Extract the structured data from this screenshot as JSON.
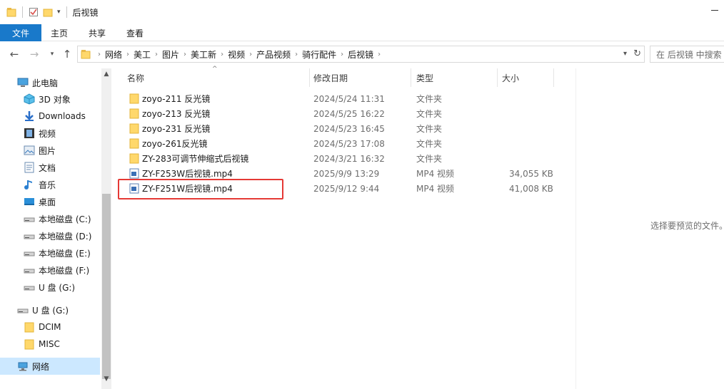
{
  "window": {
    "title": "后视镜"
  },
  "ribbon": {
    "file": "文件",
    "home": "主页",
    "share": "共享",
    "view": "查看"
  },
  "address": {
    "crumbs": [
      "网络",
      "美工",
      "图片",
      "美工新",
      "视频",
      "产品视频",
      "骑行配件",
      "后视镜"
    ]
  },
  "search": {
    "placeholder": "在 后视镜 中搜索"
  },
  "nav": {
    "items": [
      {
        "label": "此电脑",
        "icon": "pc-icon"
      },
      {
        "label": "3D 对象",
        "icon": "3d-objects-icon"
      },
      {
        "label": "Downloads",
        "icon": "download-icon"
      },
      {
        "label": "视频",
        "icon": "video-icon"
      },
      {
        "label": "图片",
        "icon": "pictures-icon"
      },
      {
        "label": "文档",
        "icon": "documents-icon"
      },
      {
        "label": "音乐",
        "icon": "music-icon"
      },
      {
        "label": "桌面",
        "icon": "desktop-icon"
      },
      {
        "label": "本地磁盘 (C:)",
        "icon": "drive-icon"
      },
      {
        "label": "本地磁盘 (D:)",
        "icon": "drive-icon"
      },
      {
        "label": "本地磁盘 (E:)",
        "icon": "drive-icon"
      },
      {
        "label": "本地磁盘 (F:)",
        "icon": "drive-icon"
      },
      {
        "label": "U 盘 (G:)",
        "icon": "usb-drive-icon"
      },
      {
        "label": "U 盘 (G:)",
        "icon": "usb-drive-icon"
      },
      {
        "label": "DCIM",
        "icon": "folder-icon"
      },
      {
        "label": "MISC",
        "icon": "folder-icon"
      },
      {
        "label": "网络",
        "icon": "network-icon"
      }
    ]
  },
  "columns": {
    "name": "名称",
    "date": "修改日期",
    "type": "类型",
    "size": "大小"
  },
  "files": [
    {
      "name": "zoyo-211 反光镜",
      "date": "2024/5/24 11:31",
      "type": "文件夹",
      "size": "",
      "icon": "folder"
    },
    {
      "name": "zoyo-213 反光镜",
      "date": "2024/5/25 16:22",
      "type": "文件夹",
      "size": "",
      "icon": "folder"
    },
    {
      "name": "zoyo-231 反光镜",
      "date": "2024/5/23 16:45",
      "type": "文件夹",
      "size": "",
      "icon": "folder"
    },
    {
      "name": "zoyo-261反光镜",
      "date": "2024/5/23 17:08",
      "type": "文件夹",
      "size": "",
      "icon": "folder"
    },
    {
      "name": "ZY-283可调节伸缩式后视镜",
      "date": "2024/3/21 16:32",
      "type": "文件夹",
      "size": "",
      "icon": "folder"
    },
    {
      "name": "ZY-F253W后视镜.mp4",
      "date": "2025/9/9 13:29",
      "type": "MP4 视频",
      "size": "34,055 KB",
      "icon": "mp4"
    },
    {
      "name": "ZY-F251W后视镜.mp4",
      "date": "2025/9/12 9:44",
      "type": "MP4 视频",
      "size": "41,008 KB",
      "icon": "mp4"
    }
  ],
  "preview": {
    "empty_text": "选择要预览的文件。"
  },
  "colors": {
    "accent": "#1979ca",
    "selection": "#cce8ff",
    "highlight": "#e53935"
  }
}
